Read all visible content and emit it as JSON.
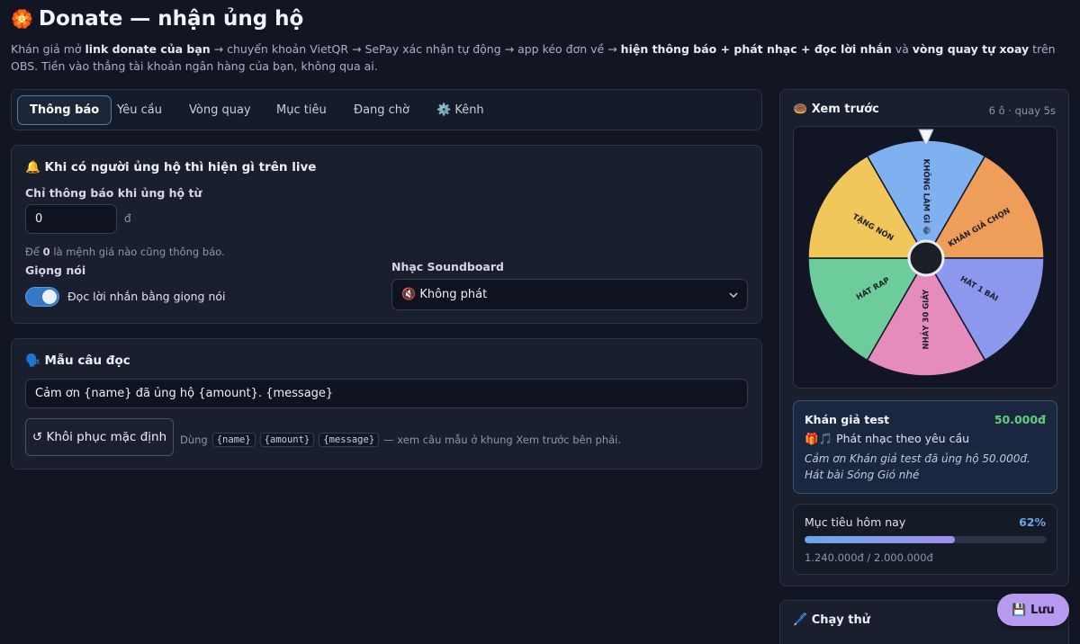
{
  "header": {
    "title_icon": "🏵️",
    "title": "Donate — nhận ủng hộ",
    "subtitle_parts": [
      {
        "text": "Khán giả mở ",
        "bold": false
      },
      {
        "text": "link donate của bạn",
        "bold": true
      },
      {
        "text": " → chuyển khoản VietQR → SePay xác nhận tự động → app kéo đơn về → ",
        "bold": false
      },
      {
        "text": "hiện thông báo + phát nhạc + đọc lời nhắn",
        "bold": true
      },
      {
        "text": " và ",
        "bold": false
      },
      {
        "text": "vòng quay tự xoay",
        "bold": true
      },
      {
        "text": " trên OBS. Tiền vào thẳng tài khoản ngân hàng của bạn, không qua ai.",
        "bold": false
      }
    ]
  },
  "tabs": [
    {
      "label": "Thông báo",
      "active": true
    },
    {
      "label": "Yêu cầu",
      "active": false
    },
    {
      "label": "Vòng quay",
      "active": false
    },
    {
      "label": "Mục tiêu",
      "active": false
    },
    {
      "label": "Đang chờ",
      "active": false
    },
    {
      "label": "⚙️ Kênh",
      "active": false
    }
  ],
  "alert_section": {
    "title": "🔔 Khi có người ủng hộ thì hiện gì trên live",
    "min_label": "Chỉ thông báo khi ủng hộ từ",
    "min_value": "0",
    "min_unit": "đ",
    "min_hint_prefix": "Để ",
    "min_hint_bold": "0",
    "min_hint_suffix": " là mệnh giá nào cũng thông báo.",
    "voice_label": "Giọng nói",
    "voice_toggle_on": true,
    "voice_toggle_text": "Đọc lời nhắn bằng giọng nói",
    "sound_label": "Nhạc Soundboard",
    "sound_value": "🔇 Không phát"
  },
  "template_section": {
    "title": "🗣️ Mẫu câu đọc",
    "template_value": "Cảm ơn {name} đã ủng hộ {amount}. {message}",
    "reset_button": "↺ Khôi phục mặc định",
    "hint_prefix": "Dùng",
    "tokens": [
      "{name}",
      "{amount}",
      "{message}"
    ],
    "hint_suffix": "— xem câu mẫu ở khung Xem trước bên phải."
  },
  "preview": {
    "title": "🍩 Xem trước",
    "meta": "6 ô · quay 5s",
    "wheel": {
      "segments": [
        {
          "label": "KHÔNG LÀM GÌ 😂",
          "color": "#7fb0f0"
        },
        {
          "label": "KHÁN GIẢ CHỌN",
          "color": "#ee9e58"
        },
        {
          "label": "HÁT 1 BÀI",
          "color": "#8c97ee"
        },
        {
          "label": "NHẢY 30 GIÂY",
          "color": "#e68cbc"
        },
        {
          "label": "HÁT RAP",
          "color": "#6ccc9b"
        },
        {
          "label": "TẶNG NÓN",
          "color": "#f1c75c"
        }
      ]
    },
    "donor": {
      "name": "Khán giả test",
      "amount": "50.000đ",
      "action": "🎁🎵 Phát nhạc theo yêu cầu",
      "message": "Cảm ơn Khán giả test đã ủng hộ 50.000đ. Hát bài Sóng Gió nhé"
    },
    "goal": {
      "label": "Mục tiêu hôm nay",
      "percent_text": "62%",
      "progress": 0.62,
      "amount_text": "1.240.000đ / 2.000.000đ"
    }
  },
  "test_panel": {
    "title": "🖊️ Chạy thử"
  },
  "save_button": {
    "label": "💾 Lưu"
  },
  "colors": {
    "accent": "#3578c6",
    "amount_green": "#5fd07a",
    "goal_blue": "#6aa6e6",
    "save_purple": "#b79af0"
  }
}
